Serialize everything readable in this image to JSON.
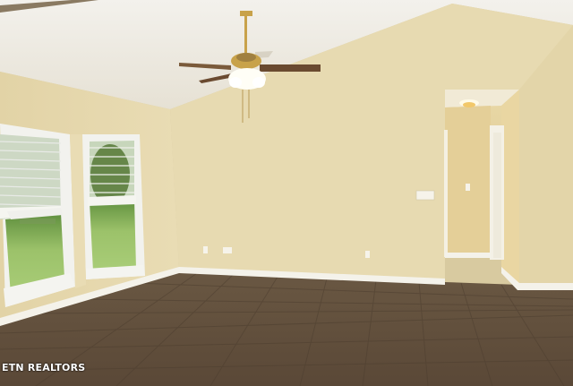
{
  "photo": {
    "subject": "empty-room-with-ceiling-fan",
    "colors": {
      "ceiling": "#efece6",
      "wall": "#e6d9b0",
      "wall_shadow": "#d7c79a",
      "floor": "#6e5a44",
      "floor_grout": "#5a4836",
      "trim": "#f4f2ea",
      "window_frame": "#f2f2ee",
      "lawn": "#9fc470",
      "fan_brass": "#c8a24a",
      "fan_blade": "#6a4a30"
    }
  },
  "watermark": {
    "text": "ETN REALTORS"
  }
}
